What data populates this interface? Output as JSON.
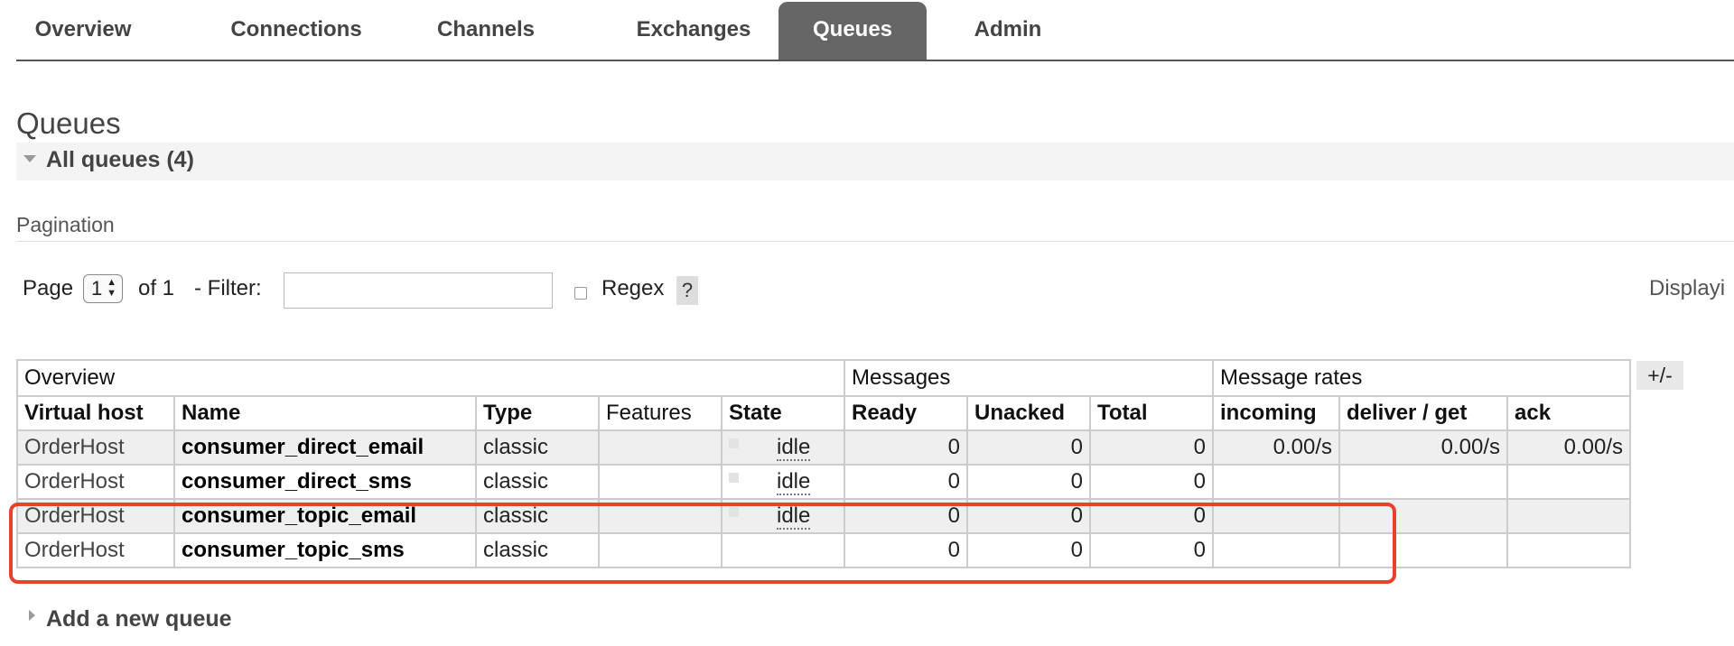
{
  "nav": {
    "tabs": [
      {
        "label": "Overview",
        "active": false
      },
      {
        "label": "Connections",
        "active": false
      },
      {
        "label": "Channels",
        "active": false
      },
      {
        "label": "Exchanges",
        "active": false
      },
      {
        "label": "Queues",
        "active": true
      },
      {
        "label": "Admin",
        "active": false
      }
    ]
  },
  "page": {
    "title": "Queues",
    "section_label": "All queues (4)"
  },
  "pagination": {
    "heading": "Pagination",
    "page_label": "Page",
    "page_value": "1",
    "of_label": "of 1",
    "filter_label": "- Filter:",
    "filter_value": "",
    "regex_label": "Regex",
    "regex_checked": false,
    "help_label": "?",
    "displaying_label": "Displayi"
  },
  "table": {
    "groups": [
      {
        "label": "Overview"
      },
      {
        "label": "Messages"
      },
      {
        "label": "Message rates"
      }
    ],
    "columns_toggle": "+/-",
    "headers": {
      "vhost": "Virtual host",
      "name": "Name",
      "type": "Type",
      "features": "Features",
      "state": "State",
      "ready": "Ready",
      "unacked": "Unacked",
      "total": "Total",
      "incoming": "incoming",
      "deliver_get": "deliver / get",
      "ack": "ack"
    },
    "rows": [
      {
        "vhost": "OrderHost",
        "name": "consumer_direct_email",
        "type": "classic",
        "features": "",
        "state": "idle",
        "ready": "0",
        "unacked": "0",
        "total": "0",
        "incoming": "0.00/s",
        "deliver_get": "0.00/s",
        "ack": "0.00/s"
      },
      {
        "vhost": "OrderHost",
        "name": "consumer_direct_sms",
        "type": "classic",
        "features": "",
        "state": "idle",
        "ready": "0",
        "unacked": "0",
        "total": "0",
        "incoming": "",
        "deliver_get": "",
        "ack": ""
      },
      {
        "vhost": "OrderHost",
        "name": "consumer_topic_email",
        "type": "classic",
        "features": "",
        "state": "idle",
        "ready": "0",
        "unacked": "0",
        "total": "0",
        "incoming": "",
        "deliver_get": "",
        "ack": ""
      },
      {
        "vhost": "OrderHost",
        "name": "consumer_topic_sms",
        "type": "classic",
        "features": "",
        "state": "",
        "ready": "0",
        "unacked": "0",
        "total": "0",
        "incoming": "",
        "deliver_get": "",
        "ack": ""
      }
    ]
  },
  "add_queue": {
    "label": "Add a new queue"
  },
  "colors": {
    "active_tab": "#666666",
    "highlight": "#e8412d"
  }
}
